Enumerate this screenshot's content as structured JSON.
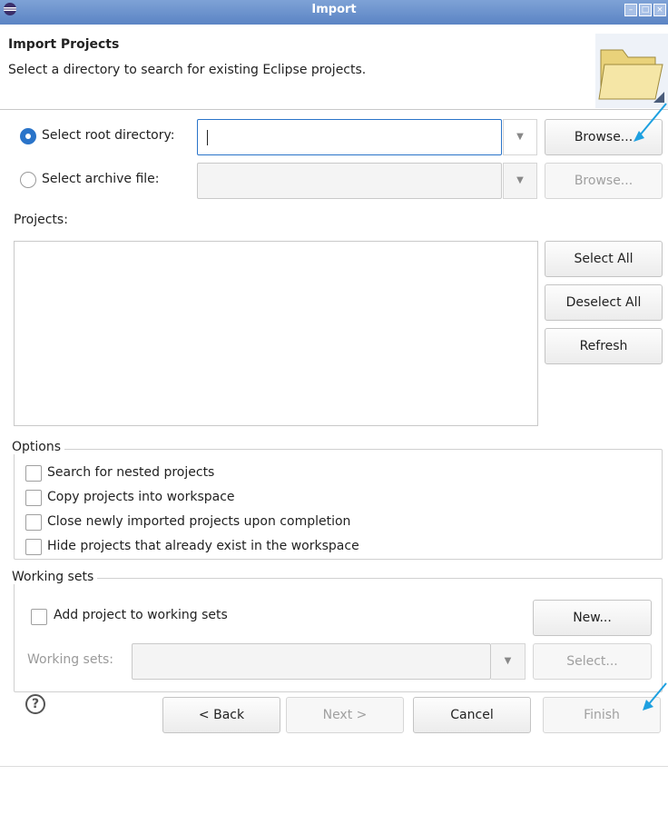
{
  "window": {
    "title": "Import",
    "controls": [
      "minimize",
      "maximize",
      "close"
    ]
  },
  "header": {
    "title": "Import Projects",
    "description": "Select a directory to search for existing Eclipse projects.",
    "icon": "folder-icon"
  },
  "source": {
    "root_directory": {
      "label": "Select root directory:",
      "selected": true,
      "value": "",
      "browse_label": "Browse..."
    },
    "archive_file": {
      "label": "Select archive file:",
      "selected": false,
      "value": "",
      "browse_label": "Browse..."
    }
  },
  "projects": {
    "label": "Projects:",
    "items": [],
    "buttons": {
      "select_all": "Select All",
      "deselect_all": "Deselect All",
      "refresh": "Refresh"
    }
  },
  "options": {
    "title": "Options",
    "items": [
      {
        "label": "Search for nested projects",
        "checked": false
      },
      {
        "label": "Copy projects into workspace",
        "checked": false
      },
      {
        "label": "Close newly imported projects upon completion",
        "checked": false
      },
      {
        "label": "Hide projects that already exist in the workspace",
        "checked": false
      }
    ]
  },
  "working_sets": {
    "title": "Working sets",
    "add_label": "Add project to working sets",
    "add_checked": false,
    "new_label": "New...",
    "sets_label": "Working sets:",
    "sets_value": "",
    "select_label": "Select..."
  },
  "footer": {
    "help_icon": "help-icon",
    "back_label": "< Back",
    "next_label": "Next >",
    "cancel_label": "Cancel",
    "finish_label": "Finish"
  },
  "colors": {
    "accent": "#2a74c9",
    "titlebar": "#5b84c4",
    "annotation_arrow": "#1ea0e0"
  }
}
